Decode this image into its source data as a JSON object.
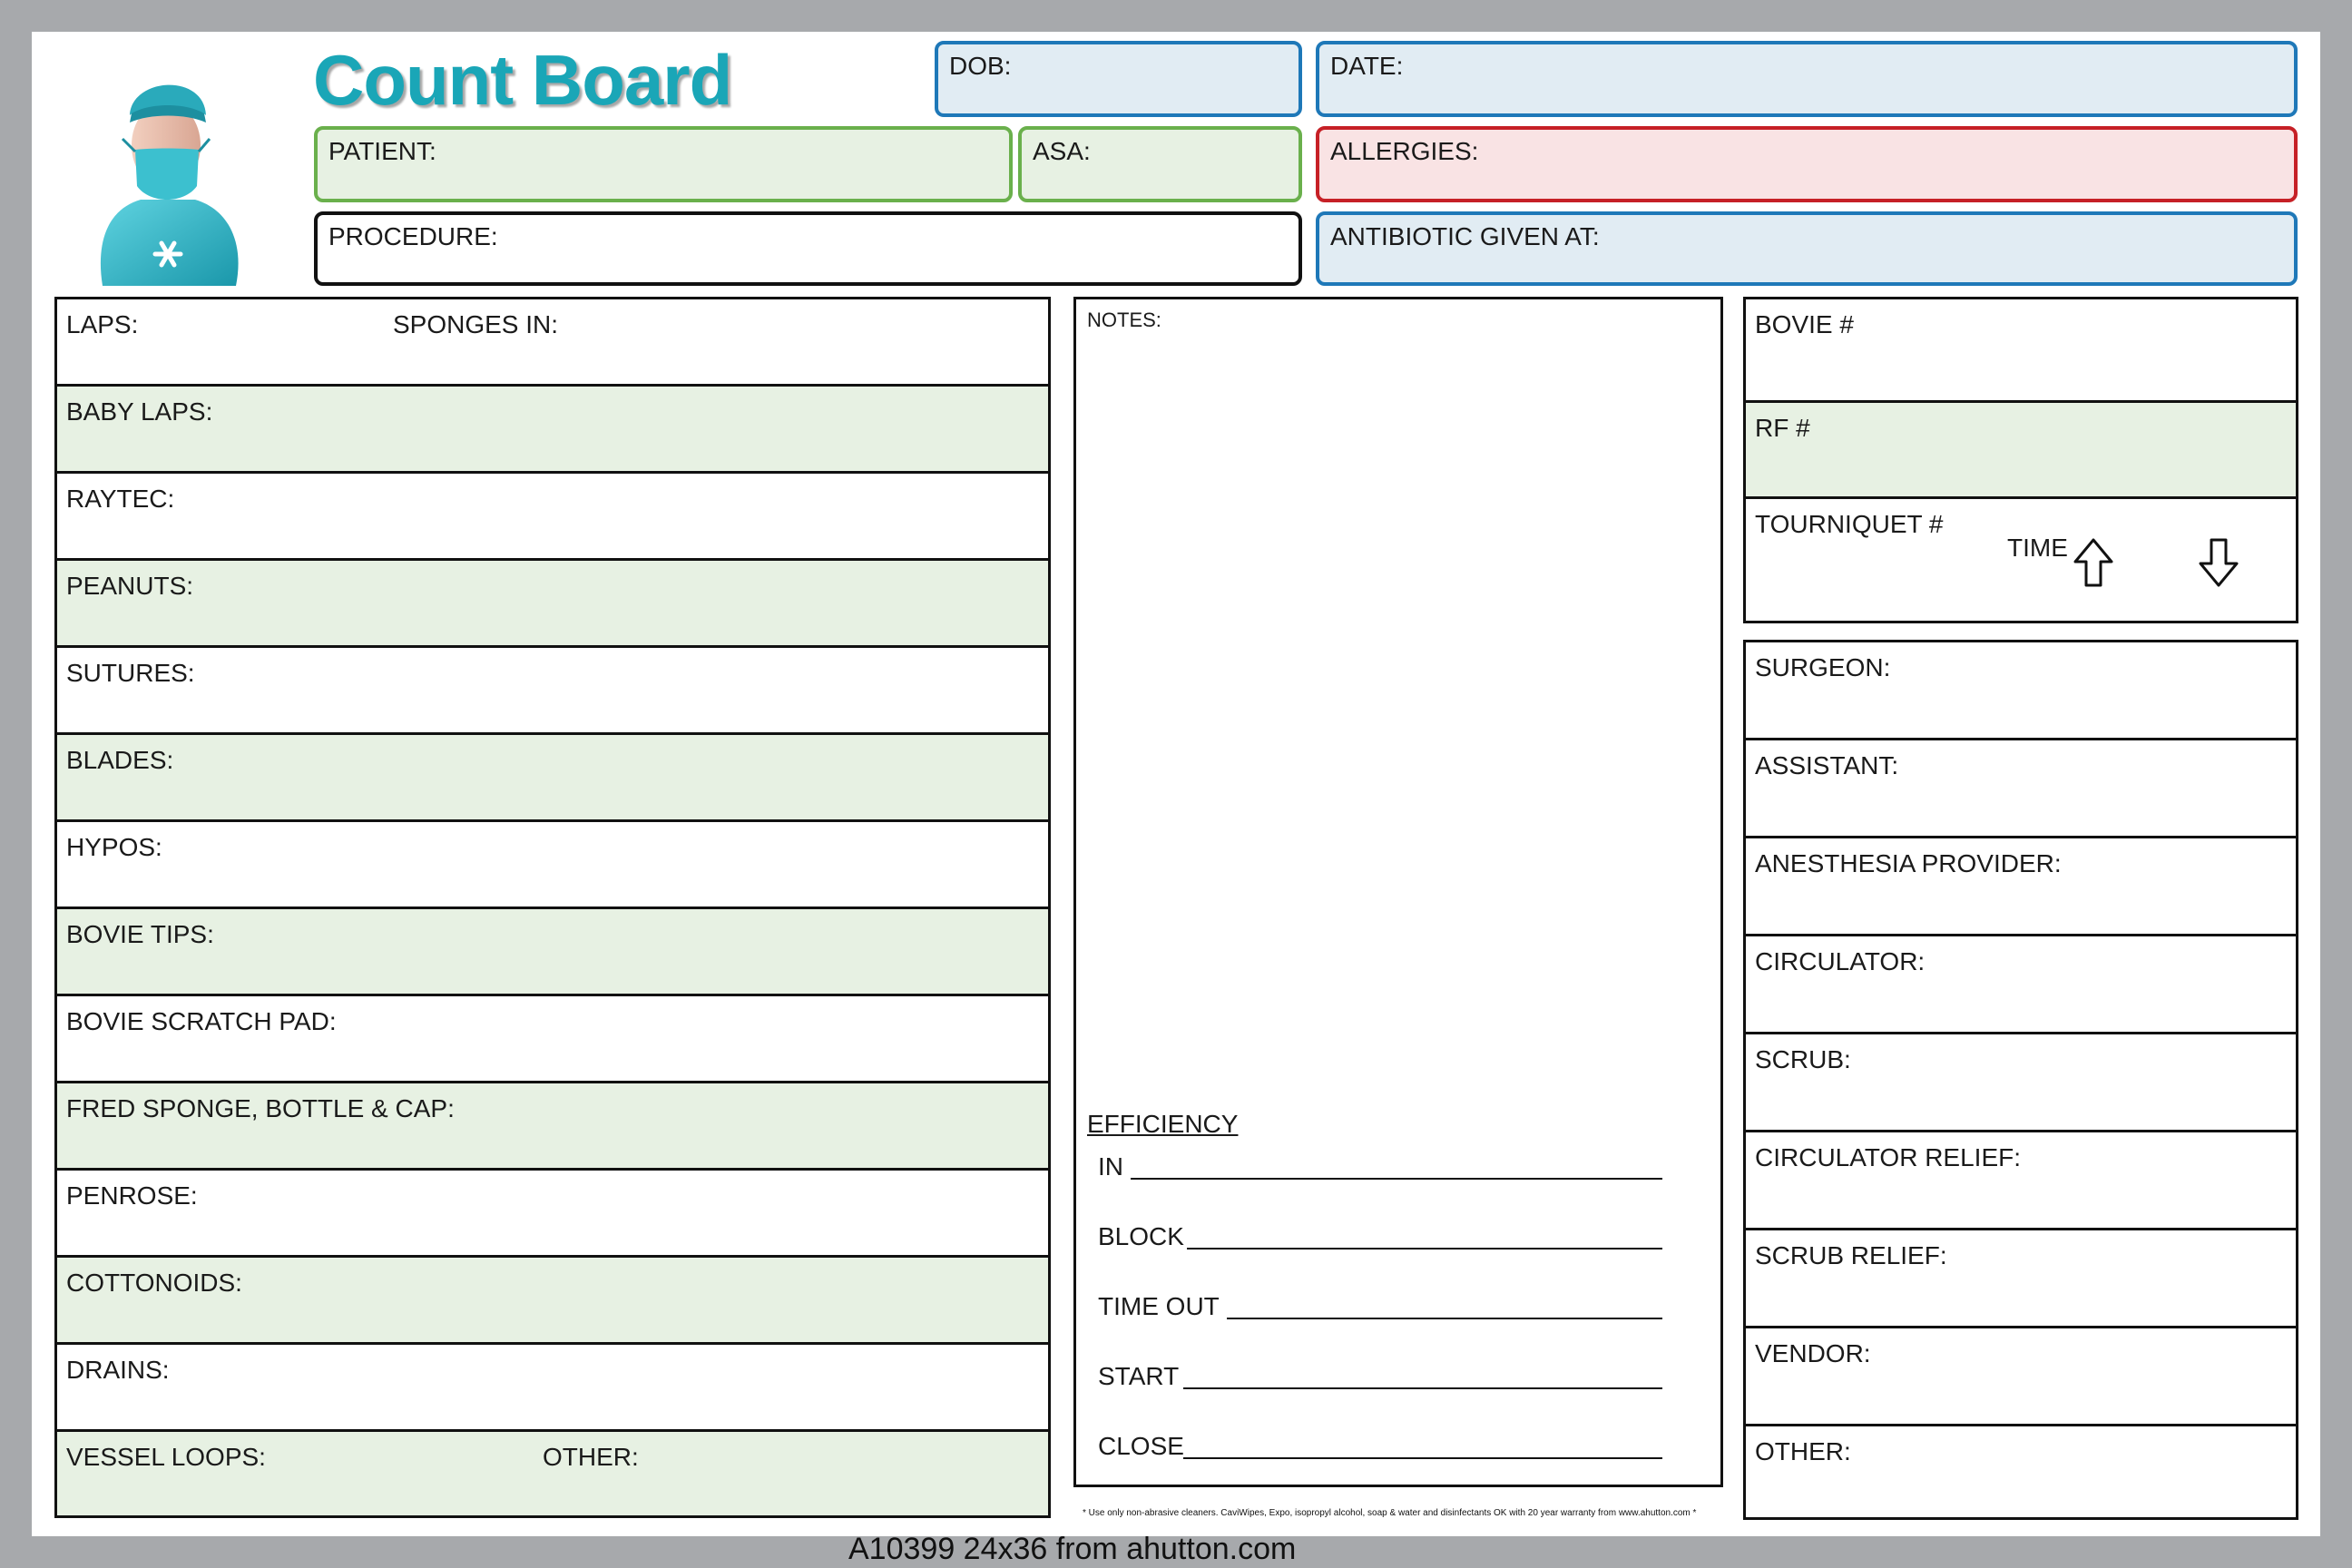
{
  "title": "Count Board",
  "header": {
    "dob": "DOB:",
    "date": "DATE:",
    "patient": "PATIENT:",
    "asa": "ASA:",
    "allergies": "ALLERGIES:",
    "procedure": "PROCEDURE:",
    "antibiotic": "ANTIBIOTIC GIVEN AT:"
  },
  "counts": {
    "sponges_in": "SPONGES IN:",
    "other": "OTHER:",
    "rows": [
      "LAPS:",
      "BABY LAPS:",
      "RAYTEC:",
      "PEANUTS:",
      "SUTURES:",
      "BLADES:",
      "HYPOS:",
      "BOVIE TIPS:",
      "BOVIE SCRATCH PAD:",
      "FRED SPONGE, BOTTLE & CAP:",
      "PENROSE:",
      "COTTONOIDS:",
      "DRAINS:",
      "VESSEL LOOPS:"
    ]
  },
  "notes": {
    "label": "NOTES:",
    "efficiency": "EFFICIENCY",
    "lines": [
      "IN",
      "BLOCK",
      "TIME OUT",
      "START",
      "CLOSE"
    ],
    "disclaimer": "* Use only non-abrasive cleaners. CaviWipes, Expo, isopropyl alcohol, soap & water and disinfectants OK with 20 year warranty from www.ahutton.com *"
  },
  "equipment": {
    "bovie": "BOVIE #",
    "rf": "RF #",
    "tourniquet": "TOURNIQUET #",
    "time": "TIME"
  },
  "staff": [
    "SURGEON:",
    "ASSISTANT:",
    "ANESTHESIA PROVIDER:",
    "CIRCULATOR:",
    "SCRUB:",
    "CIRCULATOR RELIEF:",
    "SCRUB RELIEF:",
    "VENDOR:",
    "OTHER:"
  ],
  "footer": "A10399  24x36 from ahutton.com",
  "colors": {
    "brand_teal": "#1aa6b7",
    "blue_border": "#1e78b8",
    "green_border": "#6ab04c",
    "red_border": "#c62026",
    "green_fill": "#e7f1e3",
    "blue_fill": "#e1ecf3",
    "red_fill": "#f9e3e4"
  },
  "icons": {
    "logo": "surgeon-avatar-icon",
    "up": "arrow-up-icon",
    "down": "arrow-down-icon"
  }
}
